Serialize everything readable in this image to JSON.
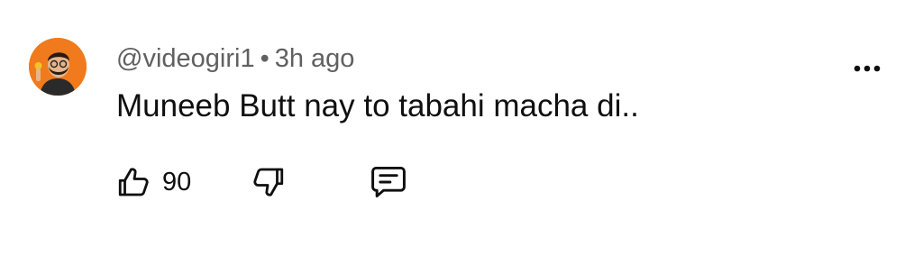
{
  "comment": {
    "author": "@videogiri1",
    "separator": "•",
    "time": "3h ago",
    "text": "Muneeb Butt nay to tabahi macha di..",
    "like_count": "90"
  },
  "icons": {
    "avatar": "avatar-illustration",
    "more": "more-vert-icon",
    "like": "thumb-up-icon",
    "dislike": "thumb-down-icon",
    "reply": "comment-icon"
  },
  "colors": {
    "avatar_bg": "#f07a1c",
    "meta_text": "#606060",
    "body_text": "#0f0f0f"
  }
}
